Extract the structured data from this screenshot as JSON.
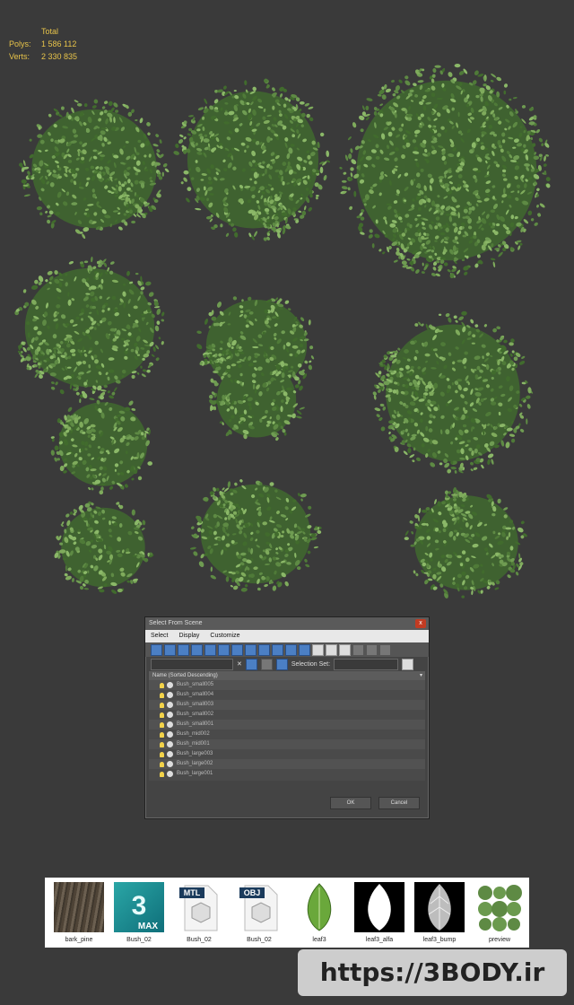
{
  "stats": {
    "header": "Total",
    "polys_label": "Polys:",
    "polys_value": "1 586 112",
    "verts_label": "Verts:",
    "verts_value": "2 330 835"
  },
  "dialog": {
    "title": "Select From Scene",
    "close": "x",
    "menu": [
      "Select",
      "Display",
      "Customize"
    ],
    "selection_set_label": "Selection Set:",
    "column_header": "Name (Sorted Descending)",
    "items": [
      "Bush_small005",
      "Bush_small004",
      "Bush_small003",
      "Bush_small002",
      "Bush_small001",
      "Bush_mid002",
      "Bush_mid001",
      "Bush_large003",
      "Bush_large002",
      "Bush_large001"
    ],
    "ok": "OK",
    "cancel": "Cancel"
  },
  "assets": [
    {
      "name": "bark_pine",
      "type": "texture"
    },
    {
      "name": "Bush_02",
      "type": "max",
      "badge": "MAX"
    },
    {
      "name": "Bush_02",
      "type": "mtl",
      "badge": "MTL"
    },
    {
      "name": "Bush_02",
      "type": "obj",
      "badge": "OBJ"
    },
    {
      "name": "leaf3",
      "type": "leaf"
    },
    {
      "name": "leaf3_alfa",
      "type": "alpha"
    },
    {
      "name": "leaf3_bump",
      "type": "bump"
    },
    {
      "name": "preview",
      "type": "preview"
    }
  ],
  "watermark": "https://3BODY.ir",
  "colors": {
    "background": "#3a3a3a",
    "stats": "#e8c44a",
    "foliage": "#5e8a44"
  }
}
